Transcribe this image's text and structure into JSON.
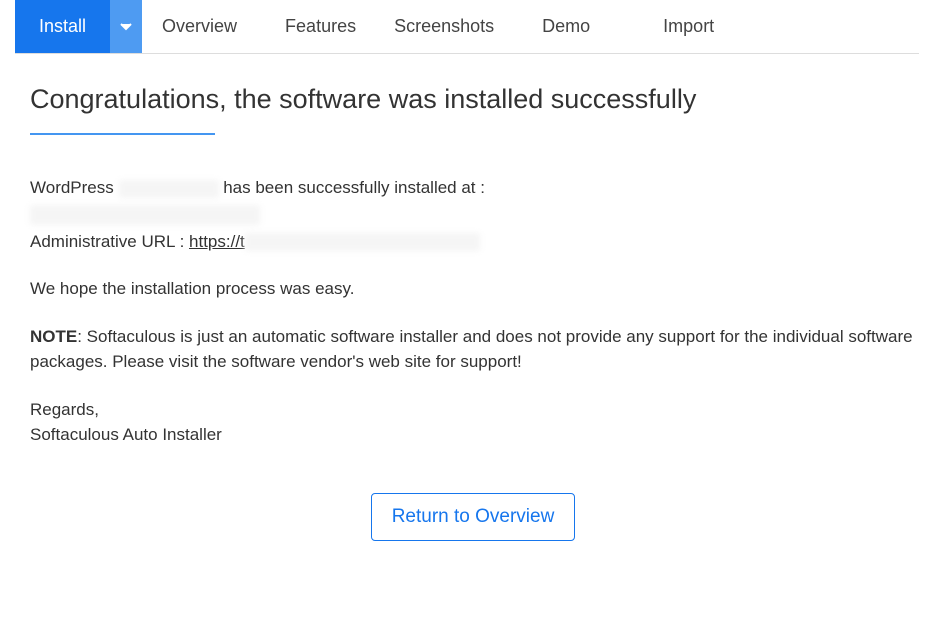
{
  "tabs": {
    "install": "Install",
    "overview": "Overview",
    "features": "Features",
    "screenshots": "Screenshots",
    "demo": "Demo",
    "import": "Import"
  },
  "content": {
    "heading": "Congratulations, the software was installed successfully",
    "line1_prefix": "WordPress ",
    "line1_suffix": " has been successfully installed at :",
    "admin_url_label": "Administrative URL : ",
    "admin_url_prefix": "https://t",
    "hope_line": "We hope the installation process was easy.",
    "note_label": "NOTE",
    "note_text": ": Softaculous is just an automatic software installer and does not provide any support for the individual software packages. Please visit the software vendor's web site for support!",
    "regards": "Regards,",
    "signature": "Softaculous Auto Installer",
    "return_button": "Return to Overview"
  }
}
